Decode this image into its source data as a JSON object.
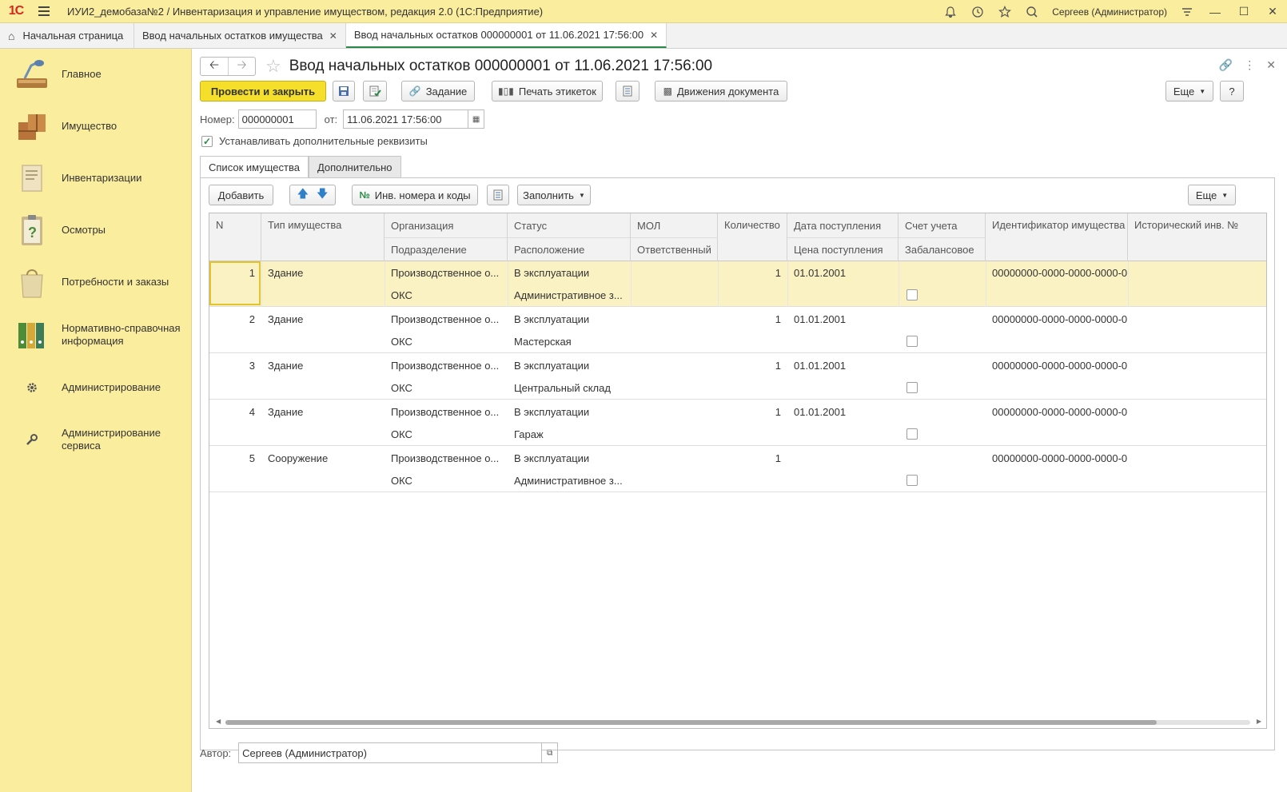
{
  "titlebar": {
    "logo": "1C",
    "app_title": "ИУИ2_демобаза№2 / Инвентаризация и управление имуществом, редакция 2.0  (1С:Предприятие)",
    "user": "Сергеев (Администратор)"
  },
  "tabs": {
    "home": "Начальная страница",
    "tab1": "Ввод начальных остатков имущества",
    "tab2": "Ввод начальных остатков 000000001 от 11.06.2021 17:56:00"
  },
  "sidebar": {
    "items": [
      {
        "label": "Главное"
      },
      {
        "label": "Имущество"
      },
      {
        "label": "Инвентаризации"
      },
      {
        "label": "Осмотры"
      },
      {
        "label": "Потребности и заказы"
      },
      {
        "label": "Нормативно-справочная информация"
      },
      {
        "label": "Администрирование"
      },
      {
        "label": "Администрирование сервиса"
      }
    ]
  },
  "form": {
    "title": "Ввод начальных остатков 000000001 от 11.06.2021 17:56:00",
    "post_close": "Провести и закрыть",
    "task": "Задание",
    "print_labels": "Печать этикеток",
    "doc_movements": "Движения документа",
    "more": "Еще",
    "help": "?",
    "number_label": "Номер:",
    "number_value": "000000001",
    "date_label": "от:",
    "date_value": "11.06.2021 17:56:00",
    "checkbox_label": "Устанавливать дополнительные реквизиты",
    "tab_list": "Список имущества",
    "tab_extra": "Дополнительно",
    "add": "Добавить",
    "inv_numbers": "Инв. номера и коды",
    "fill": "Заполнить",
    "author_label": "Автор:",
    "author_value": "Сергеев (Администратор)"
  },
  "table": {
    "headers_top": [
      "N",
      "Тип имущества",
      "Организация",
      "Статус",
      "МОЛ",
      "Количество",
      "Дата поступления",
      "Счет учета",
      "Идентификатор имущества",
      "Исторический инв. №"
    ],
    "headers_bottom": [
      "Подразделение",
      "Расположение",
      "Ответственный",
      "Цена поступления",
      "Забалансовое"
    ],
    "rows": [
      {
        "n": "1",
        "type": "Здание",
        "org": "Производственное о...",
        "status": "В эксплуатации",
        "qty": "1",
        "date": "01.01.2001",
        "id": "00000000-0000-0000-0000-0",
        "dept": "ОКС",
        "location": "Административное з..."
      },
      {
        "n": "2",
        "type": "Здание",
        "org": "Производственное о...",
        "status": "В эксплуатации",
        "qty": "1",
        "date": "01.01.2001",
        "id": "00000000-0000-0000-0000-0",
        "dept": "ОКС",
        "location": "Мастерская"
      },
      {
        "n": "3",
        "type": "Здание",
        "org": "Производственное о...",
        "status": "В эксплуатации",
        "qty": "1",
        "date": "01.01.2001",
        "id": "00000000-0000-0000-0000-0",
        "dept": "ОКС",
        "location": "Центральный склад"
      },
      {
        "n": "4",
        "type": "Здание",
        "org": "Производственное о...",
        "status": "В эксплуатации",
        "qty": "1",
        "date": "01.01.2001",
        "id": "00000000-0000-0000-0000-0",
        "dept": "ОКС",
        "location": "Гараж"
      },
      {
        "n": "5",
        "type": "Сооружение",
        "org": "Производственное о...",
        "status": "В эксплуатации",
        "qty": "1",
        "date": "",
        "id": "00000000-0000-0000-0000-0",
        "dept": "ОКС",
        "location": "Административное з..."
      }
    ]
  }
}
